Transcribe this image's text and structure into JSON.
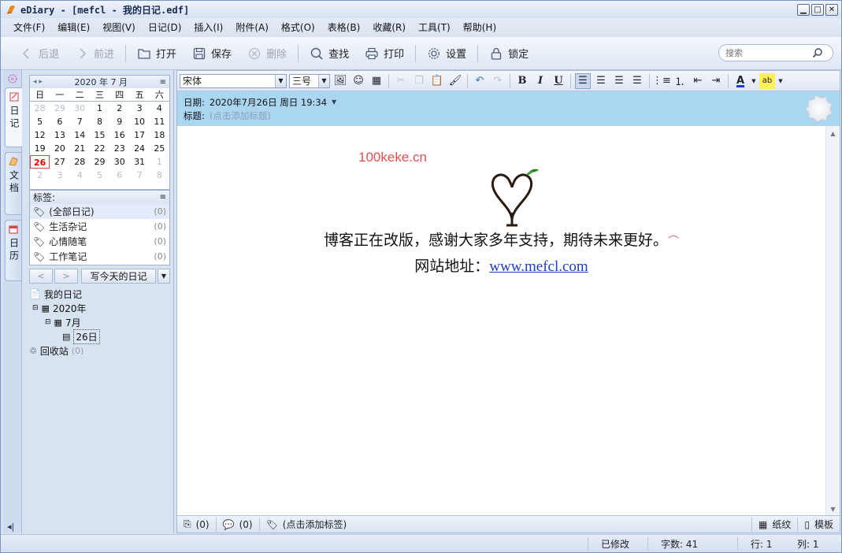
{
  "window": {
    "title": "eDiary - [mefcl - 我的日记.edf]"
  },
  "menu": [
    "文件(F)",
    "编辑(E)",
    "视图(V)",
    "日记(D)",
    "插入(I)",
    "附件(A)",
    "格式(O)",
    "表格(B)",
    "收藏(R)",
    "工具(T)",
    "帮助(H)"
  ],
  "toolbar": {
    "back": "后退",
    "forward": "前进",
    "open": "打开",
    "save": "保存",
    "delete": "删除",
    "find": "查找",
    "print": "打印",
    "settings": "设置",
    "lock": "锁定",
    "search_placeholder": "搜索"
  },
  "vtabs": {
    "diary": "日记",
    "docs": "文档",
    "calendar": "日历"
  },
  "calendar": {
    "year_month": "2020 年 7 月",
    "weekdays": [
      "日",
      "一",
      "二",
      "三",
      "四",
      "五",
      "六"
    ],
    "days": [
      [
        "28",
        "29",
        "30",
        "1",
        "2",
        "3",
        "4"
      ],
      [
        "5",
        "6",
        "7",
        "8",
        "9",
        "10",
        "11"
      ],
      [
        "12",
        "13",
        "14",
        "15",
        "16",
        "17",
        "18"
      ],
      [
        "19",
        "20",
        "21",
        "22",
        "23",
        "24",
        "25"
      ],
      [
        "26",
        "27",
        "28",
        "29",
        "30",
        "31",
        "1"
      ],
      [
        "2",
        "3",
        "4",
        "5",
        "6",
        "7",
        "8"
      ]
    ],
    "today": "26"
  },
  "tags": {
    "header": "标签:",
    "items": [
      {
        "label": "(全部日记)",
        "count": "(0)"
      },
      {
        "label": "生活杂记",
        "count": "(0)"
      },
      {
        "label": "心情随笔",
        "count": "(0)"
      },
      {
        "label": "工作笔记",
        "count": "(0)"
      }
    ]
  },
  "nav": {
    "prev": "<",
    "next": ">",
    "write_today": "写今天的日记"
  },
  "tree": {
    "root": "我的日记",
    "year": "2020年",
    "month": "7月",
    "day": "26日",
    "recycle": "回收站",
    "recycle_count": "(0)"
  },
  "format": {
    "font": "宋体",
    "size": "三号"
  },
  "meta": {
    "date_label": "日期:",
    "date_value": "2020年7月26日  周日  19:34",
    "title_label": "标题:",
    "title_placeholder": "(点击添加标题)"
  },
  "content": {
    "watermark": "100keke.cn",
    "line1": "博客正在改版，感谢大家多年支持，期待未来更好。",
    "line2_prefix": "网站地址：",
    "link": "www.mefcl.com"
  },
  "editor_status": {
    "attach_count": "(0)",
    "comment_count": "(0)",
    "tag_placeholder": "(点击添加标签)",
    "paper": "纸纹",
    "template": "模板"
  },
  "statusbar": {
    "modified": "已修改",
    "word_count": "字数: 41",
    "row": "行: 1",
    "col": "列: 1"
  }
}
